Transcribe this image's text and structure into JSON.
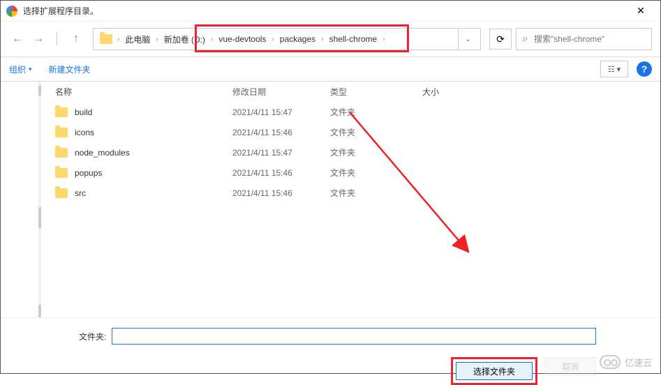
{
  "window": {
    "title": "选择扩展程序目录。"
  },
  "breadcrumb": {
    "items": [
      "此电脑",
      "新加卷 (D:)",
      "vue-devtools",
      "packages",
      "shell-chrome"
    ]
  },
  "search": {
    "placeholder": "搜索\"shell-chrome\""
  },
  "toolbar": {
    "organize": "组织",
    "new_folder": "新建文件夹"
  },
  "columns": {
    "name": "名称",
    "date": "修改日期",
    "type": "类型",
    "size": "大小"
  },
  "rows": [
    {
      "name": "build",
      "date": "2021/4/11 15:47",
      "type": "文件夹"
    },
    {
      "name": "icons",
      "date": "2021/4/11 15:46",
      "type": "文件夹"
    },
    {
      "name": "node_modules",
      "date": "2021/4/11 15:47",
      "type": "文件夹"
    },
    {
      "name": "popups",
      "date": "2021/4/11 15:46",
      "type": "文件夹"
    },
    {
      "name": "src",
      "date": "2021/4/11 15:46",
      "type": "文件夹"
    }
  ],
  "footer": {
    "folder_label": "文件夹:",
    "select_button": "选择文件夹",
    "cancel_button": "取消"
  },
  "watermark": "亿速云"
}
